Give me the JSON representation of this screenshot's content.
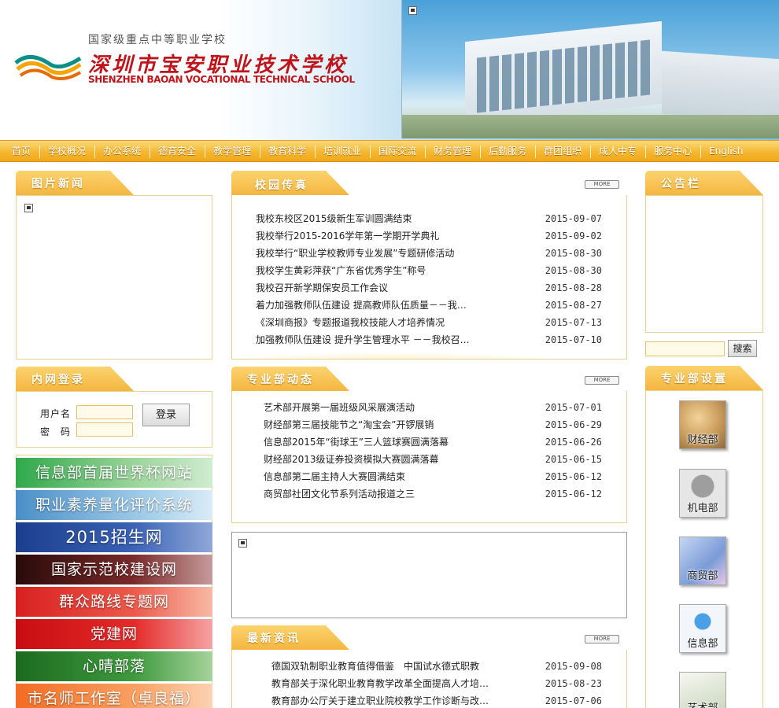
{
  "header": {
    "school_sub": "国家级重点中等职业学校",
    "school_name": "深圳市宝安职业技术学校",
    "school_en": "SHENZHEN BAOAN VOCATIONAL TECHNICAL SCHOOL"
  },
  "nav": [
    "首页",
    "学校概况",
    "办公系统",
    "德育安全",
    "教学管理",
    "教育科学",
    "培训就业",
    "国际交流",
    "财务管理",
    "后勤服务",
    "群团组织",
    "成人中专",
    "服务中心",
    "English"
  ],
  "photo_news": {
    "title": "图片新闻"
  },
  "login": {
    "title": "内网登录",
    "username_label": "用户名",
    "password_label": "密　码",
    "login_button": "登录"
  },
  "banners": [
    "信息部首届世界杯网站",
    "职业素养量化评价系统",
    "2015招生网",
    "国家示范校建设网",
    "群众路线专题网",
    "党建网",
    "心晴部落",
    "市名师工作室（卓良福）"
  ],
  "more_label": "MORE",
  "campus_news": {
    "title": "校园传真",
    "items": [
      {
        "title": "我校东校区2015级新生军训圆满结束",
        "date": "2015-09-07"
      },
      {
        "title": "我校举行2015-2016学年第一学期开学典礼",
        "date": "2015-09-02"
      },
      {
        "title": "我校举行“职业学校教师专业发展”专题研修活动",
        "date": "2015-08-30"
      },
      {
        "title": "我校学生黄彩萍获“广东省优秀学生”称号",
        "date": "2015-08-30"
      },
      {
        "title": "我校召开新学期保安员工作会议",
        "date": "2015-08-28"
      },
      {
        "title": "着力加强教师队伍建设 提高教师队伍质量－－我…",
        "date": "2015-08-27"
      },
      {
        "title": "《深圳商报》专题报道我校技能人才培养情况",
        "date": "2015-07-13"
      },
      {
        "title": "加强教师队伍建设 提升学生管理水平 －－我校召…",
        "date": "2015-07-10"
      }
    ]
  },
  "dept_news": {
    "title": "专业部动态",
    "items": [
      {
        "title": "艺术部开展第一届班级风采展演活动",
        "date": "2015-07-01"
      },
      {
        "title": "财经部第三届技能节之“淘宝会”开锣展销",
        "date": "2015-06-29"
      },
      {
        "title": "信息部2015年“街球王”三人篮球赛圆满落幕",
        "date": "2015-06-26"
      },
      {
        "title": "财经部2013级证券投资模拟大赛圆满落幕",
        "date": "2015-06-15"
      },
      {
        "title": "信息部第二届主持人大赛圆满结束",
        "date": "2015-06-12"
      },
      {
        "title": "商贸部社团文化节系列活动报道之三",
        "date": "2015-06-12"
      }
    ]
  },
  "latest_news": {
    "title": "最新资讯",
    "items": [
      {
        "title": "德国双轨制职业教育值得借鉴　中国试水德式职教",
        "date": "2015-09-08"
      },
      {
        "title": "教育部关于深化职业教育教学改革全面提高人才培…",
        "date": "2015-08-23"
      },
      {
        "title": "教育部办公厅关于建立职业院校教学工作诊断与改…",
        "date": "2015-07-06"
      }
    ]
  },
  "notice": {
    "title": "公告栏"
  },
  "search": {
    "button": "搜索"
  },
  "departments": {
    "title": "专业部设置",
    "items": [
      "财经部",
      "机电部",
      "商贸部",
      "信息部",
      "艺术部"
    ]
  },
  "colors": {
    "accent": "#f4b640",
    "nav": "#f0a81b",
    "brand_red": "#c0141b"
  }
}
